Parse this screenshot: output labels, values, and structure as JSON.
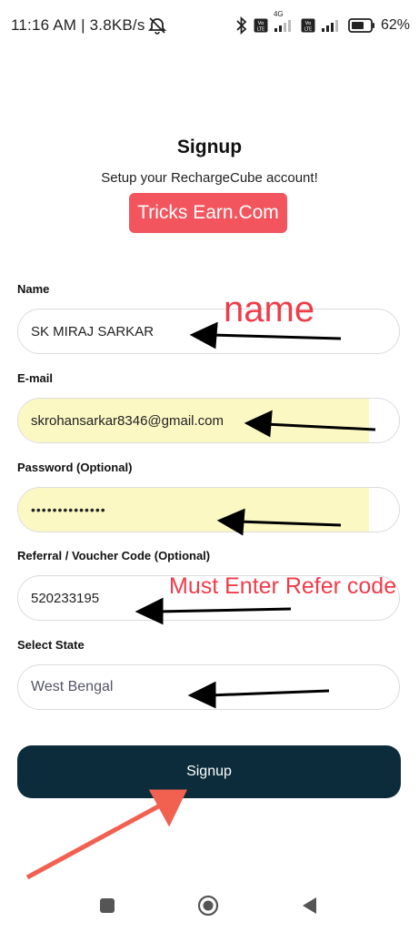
{
  "status_bar": {
    "time_speed": "11:16 AM | 3.8KB/s",
    "battery_percent": "62%",
    "icons": [
      "alarm-off-icon",
      "bluetooth-icon",
      "volte-icon",
      "signal-icon",
      "volte-icon",
      "signal-icon",
      "battery-icon"
    ],
    "network_label": "4G"
  },
  "header": {
    "title": "Signup",
    "subtitle": "Setup your RechargeCube account!",
    "brand_badge": "Tricks Earn.Com"
  },
  "form": {
    "name": {
      "label": "Name",
      "value": "SK MIRAJ SARKAR"
    },
    "email": {
      "label": "E-mail",
      "value": "skrohansarkar8346@gmail.com"
    },
    "password": {
      "label": "Password (Optional)",
      "value": "••••••••••••••"
    },
    "referral": {
      "label": "Referral / Voucher Code (Optional)",
      "value": "520233195"
    },
    "state": {
      "label": "Select State",
      "value": "West Bengal"
    }
  },
  "annotations": {
    "name_note": "name",
    "refer_note": "Must Enter Refer code"
  },
  "signup_button": {
    "label": "Signup"
  },
  "colors": {
    "button_bg": "#0c2c3b",
    "brand_badge_bg": "#f2555e",
    "annotation_red": "#ee3d4a",
    "autofill_yellow": "#fbf8c4"
  },
  "nav_bar": {
    "icons": [
      "recents-square-icon",
      "home-circle-icon",
      "back-triangle-icon"
    ]
  }
}
